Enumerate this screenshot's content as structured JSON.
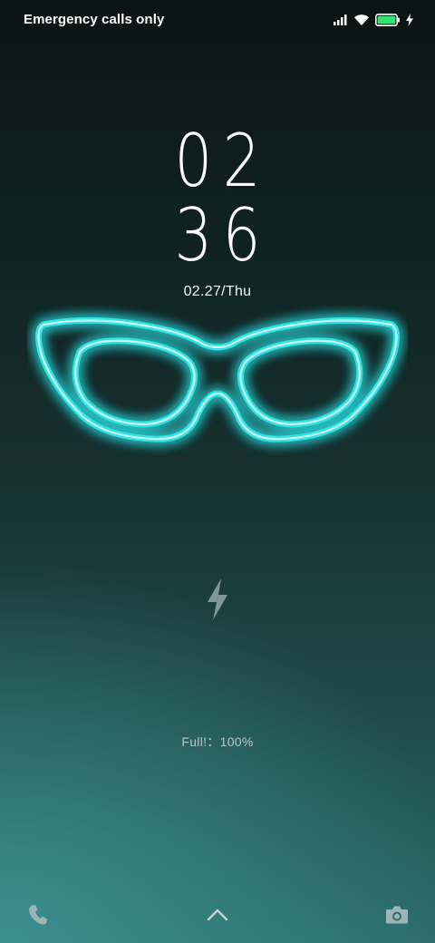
{
  "status_bar": {
    "carrier_text": "Emergency calls only",
    "icons": [
      "signal-icon",
      "wifi-icon",
      "battery-icon",
      "charging-bolt-icon"
    ],
    "battery_level": 1.0,
    "battery_color": "#2ee66b"
  },
  "lock_screen": {
    "time_hours": "02",
    "time_minutes": "36",
    "date": "02.27/Thu",
    "wallpaper_motif": "neon-glasses",
    "neon_color": "#2fe3e6",
    "charging_icon": "lightning-bolt-icon",
    "charging_status": "Full!：100%"
  },
  "bottom_bar": {
    "left_icon": "phone-icon",
    "center_icon": "chevron-up-icon",
    "right_icon": "camera-icon"
  }
}
